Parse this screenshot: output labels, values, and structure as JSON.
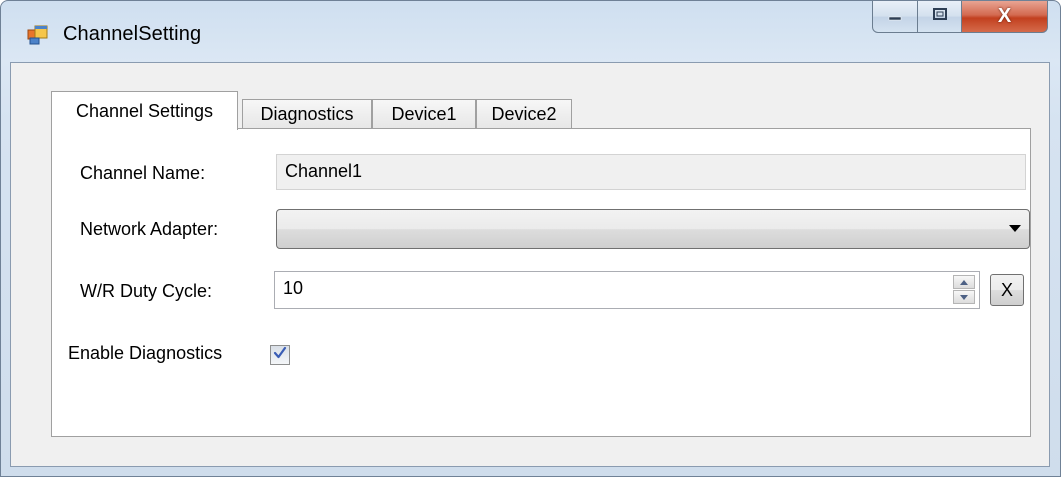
{
  "window": {
    "title": "ChannelSetting",
    "close_label": "X"
  },
  "tabs": [
    {
      "label": "Channel Settings",
      "selected": true
    },
    {
      "label": "Diagnostics",
      "selected": false
    },
    {
      "label": "Device1",
      "selected": false
    },
    {
      "label": "Device2",
      "selected": false
    }
  ],
  "form": {
    "channel_name_label": "Channel Name:",
    "channel_name_value": "Channel1",
    "network_adapter_label": "Network Adapter:",
    "network_adapter_value": "",
    "duty_cycle_label": "W/R Duty Cycle:",
    "duty_cycle_value": "10",
    "clear_button_label": "X",
    "enable_diagnostics_label": "Enable Diagnostics",
    "enable_diagnostics_checked": true
  },
  "icons": {
    "app": "app-window-icon",
    "minimize": "minimize-icon",
    "maximize": "maximize-icon",
    "close": "close-icon",
    "dropdown": "chevron-down-icon",
    "spin_up": "spin-up-icon",
    "spin_down": "spin-down-icon",
    "check": "checkmark-icon"
  },
  "colors": {
    "checkmark": "#3a5db5",
    "close_button": "#c7472a",
    "title_bar": "#dbe7f4"
  }
}
